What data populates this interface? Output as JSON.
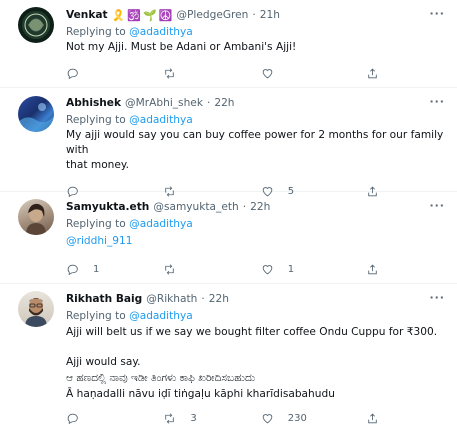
{
  "reply_prefix": "Replying to",
  "tweets": [
    {
      "name": "Venkat",
      "emojis": [
        "🎗️",
        "🕉️",
        "🌱",
        "☮️"
      ],
      "handle": "@PledgeGren",
      "time": "21h",
      "reply_to": "@adadithya",
      "lines": [
        "Not my Ajji. Must be Adani or Ambani's Ajji!"
      ],
      "replies": "",
      "retweets": "",
      "likes": ""
    },
    {
      "name": "Abhishek",
      "handle": "@MrAbhi_shek",
      "time": "22h",
      "reply_to": "@adadithya",
      "lines": [
        "My ajji would say you can buy coffee power for 2 months for our family with",
        "that money."
      ],
      "replies": "",
      "retweets": "",
      "likes": "5"
    },
    {
      "name": "Samyukta.eth",
      "handle": "@samyukta_eth",
      "time": "22h",
      "reply_to": "@adadithya",
      "mention": "@riddhi_911",
      "replies": "1",
      "retweets": "",
      "likes": "1"
    },
    {
      "name": "Rikhath Baig",
      "handle": "@Rikhath",
      "time": "22h",
      "reply_to": "@adadithya",
      "lines": [
        "Ajji will belt us if we say we bought filter coffee Ondu Cuppu for ₹300.",
        "",
        "Ajji would say.",
        "ಆ ಹಣದಲ್ಲಿ ನಾವು ಇಡೀ ತಿಂಗಳು ಕಾಫಿ ಖರೀದಿಸಬಹುದು",
        "Ā haṇadalli nāvu iḍī tiṅgaḷu kāphi kharīdisabahudu"
      ],
      "replies": "",
      "retweets": "3",
      "likes": "230"
    }
  ],
  "icons": {
    "reply": "reply-icon",
    "retweet": "retweet-icon",
    "like": "like-icon",
    "share": "share-icon",
    "more": "more-icon"
  },
  "colors": {
    "link": "#1d9bf0",
    "secondary": "#536471"
  }
}
